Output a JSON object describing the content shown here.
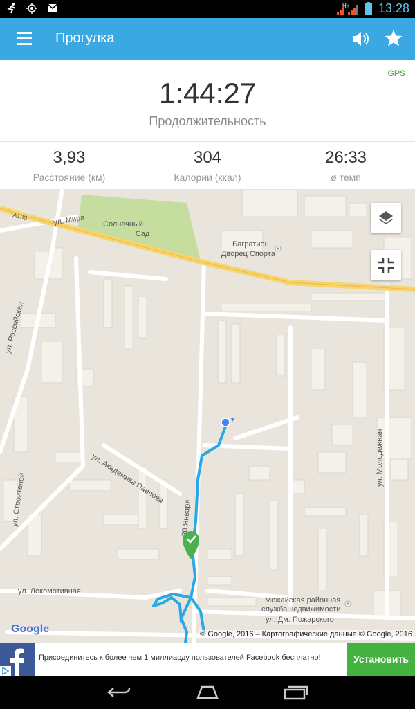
{
  "status_bar": {
    "time": "13:28",
    "network": "H+",
    "icons": [
      "running-icon",
      "gps-icon",
      "mail-icon",
      "signal-icon",
      "battery-icon"
    ]
  },
  "app_bar": {
    "title": "Прогулка",
    "icons": [
      "menu-icon",
      "volume-icon",
      "star-icon"
    ]
  },
  "stats": {
    "gps": "GPS",
    "duration": "1:44:27",
    "duration_label": "Продолжительность",
    "metrics": [
      {
        "value": "3,93",
        "label": "Расстояние (км)"
      },
      {
        "value": "304",
        "label": "Калории (ккал)"
      },
      {
        "value": "26:33",
        "label": "ø темп"
      }
    ]
  },
  "map": {
    "labels": {
      "park": "Солнечный",
      "park2": "Сад",
      "poi1": "Багратион,",
      "poi1b": "Дворец Спорта",
      "poi2": "Можайская районная",
      "poi2b": "служба недвижимости",
      "road_a": "A100",
      "s1": "ул. Мира",
      "s2": "ул. Российская",
      "s3": "ул. Академика Павлова",
      "s4": "ул. Строителей",
      "s5": "20 Января",
      "s6": "ул. Молодежная",
      "s7": "ул. Локомотивная",
      "s8": "ул. Дм. Пожарского"
    },
    "google": "Google",
    "attribution": "© Google, 2016 – Картографические данные © Google, 2016",
    "icons": [
      "layers-icon",
      "collapse-icon",
      "start-marker-icon",
      "location-dot-icon"
    ]
  },
  "ad": {
    "text": "Присоединитесь к более чем 1 миллиарду пользователей Facebook бесплатно!",
    "button": "Установить",
    "icons": [
      "facebook-icon",
      "adchoices-icon"
    ]
  },
  "nav_bar": {
    "icons": [
      "back-icon",
      "home-icon",
      "recent-apps-icon"
    ]
  },
  "colors": {
    "app_bar": "#3aa8e3",
    "gps": "#4caf50",
    "route": "#29a8e6",
    "install": "#43b23f",
    "facebook": "#3b5998"
  }
}
